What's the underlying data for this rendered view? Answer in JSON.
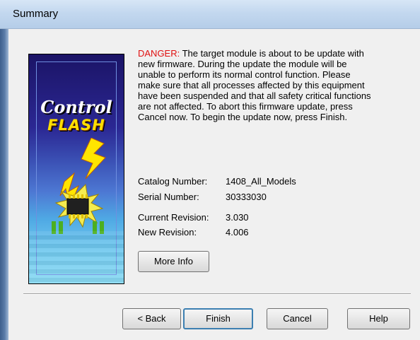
{
  "window": {
    "title": "Summary"
  },
  "side_image": {
    "title_line1": "Control",
    "title_line2": "FLASH"
  },
  "message": {
    "danger_label": "DANGER:",
    "text": " The target module is about to be update with new firmware. During the update the module will be unable to perform its normal control function. Please make sure that all processes affected by this equipment have been suspended and that all safety critical functions are not affected. To abort this firmware update, press Cancel now. To begin the update now, press Finish."
  },
  "info": {
    "catalog_label": "Catalog Number:",
    "catalog_value": "1408_All_Models",
    "serial_label": "Serial Number:",
    "serial_value": "30333030",
    "current_label": "Current Revision:",
    "current_value": "3.030",
    "new_label": "New Revision:",
    "new_value": "4.006"
  },
  "buttons": {
    "more_info": "More Info",
    "back": "< Back",
    "finish": "Finish",
    "cancel": "Cancel",
    "help": "Help"
  },
  "colors": {
    "danger": "#e01010",
    "dialog_bg": "#f0f0f0",
    "title_bar": "#c3d8ef",
    "default_button_border": "#3c7fb1"
  },
  "icons": [
    "controlflash-logo",
    "chip-lightning-icon"
  ]
}
